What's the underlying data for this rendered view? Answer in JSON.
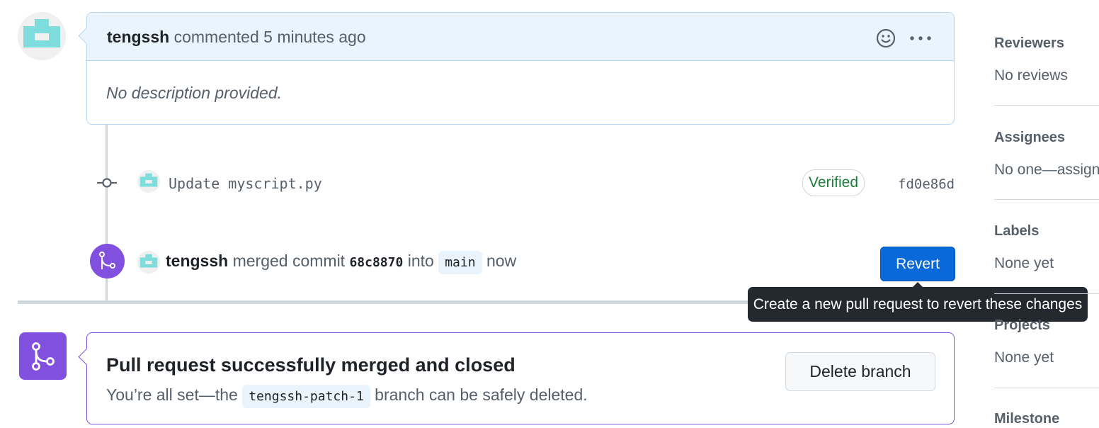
{
  "comment": {
    "author": "tengssh",
    "action": "commented",
    "time": "5 minutes ago",
    "body": "No description provided."
  },
  "commit": {
    "message": "Update myscript.py",
    "verified_label": "Verified",
    "sha": "fd0e86d"
  },
  "merge_event": {
    "author": "tengssh",
    "text_merged": "merged commit",
    "commit_sha": "68c8870",
    "text_into": "into",
    "branch": "main",
    "time": "now",
    "revert_label": "Revert",
    "tooltip": "Create a new pull request to revert these changes"
  },
  "merged_box": {
    "title": "Pull request successfully merged and closed",
    "desc_prefix": "You’re all set—the",
    "branch": "tengssh-patch-1",
    "desc_suffix": "branch can be safely deleted.",
    "delete_label": "Delete branch"
  },
  "sidebar": {
    "reviewers": {
      "heading": "Reviewers",
      "value": "No reviews"
    },
    "assignees": {
      "heading": "Assignees",
      "value": "No one—assign"
    },
    "labels": {
      "heading": "Labels",
      "value": "None yet"
    },
    "projects": {
      "heading": "Projects",
      "value": "None yet"
    },
    "milestone": {
      "heading": "Milestone"
    }
  },
  "colors": {
    "accent_blue": "#0969da",
    "merged_purple": "#8250df",
    "verified_green": "#1a7f37"
  }
}
